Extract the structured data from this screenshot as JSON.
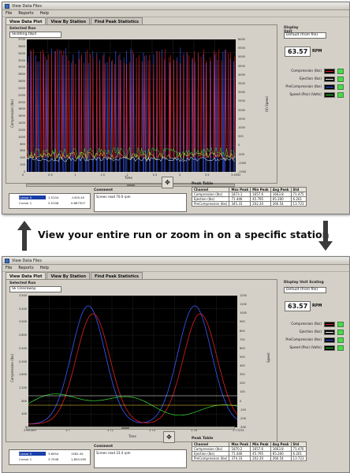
{
  "window_title": "View Data Files",
  "menu": [
    "File",
    "Reports",
    "Help"
  ],
  "tabs": [
    "View Data Plot",
    "View By Station",
    "Find Peak Statistics"
  ],
  "selected_run_label": "Selected Run",
  "selected_run_value": "Skidding.tdpd",
  "selected_run_value_2": "Sk Clearaway",
  "display_scaling_label": "Display Unit Scaling",
  "display_scaling_value": "Default (from file)",
  "rpm_value": "63.57",
  "rpm_unit": "RPM",
  "legend": [
    {
      "label": "Compression (lbs)",
      "color": "#e02020"
    },
    {
      "label": "Ejection (lbs)",
      "color": "#ffffff"
    },
    {
      "label": "PreCompression (lbs)",
      "color": "#3a5bff"
    },
    {
      "label": "Speed (Pos) (Volts)",
      "color": "#33dd33"
    }
  ],
  "time_label": "Time",
  "plot1": {
    "left_ticks": [
      "3700",
      "3600",
      "3400",
      "3200",
      "3000",
      "2800",
      "2600",
      "2400",
      "2200",
      "2000",
      "1800",
      "1600",
      "1400",
      "1200",
      "1000",
      "800",
      "600",
      "400",
      "200",
      "0"
    ],
    "right_ticks": [
      "6000",
      "5500",
      "5000",
      "4500",
      "4000",
      "3500",
      "3000",
      "2500",
      "2000",
      "1500",
      "1000",
      "500",
      "0",
      "-500",
      "-1000",
      "-1500"
    ],
    "x_ticks": [
      "0",
      "0.5",
      "1",
      "1.5",
      "2",
      "2.5",
      "3",
      "3.5",
      "3.4592"
    ],
    "left_title": "Compression (lbs)",
    "right_title": "(V) Speed"
  },
  "plot2": {
    "left_ticks": [
      "3.500",
      "3.400",
      "3.000",
      "2.800",
      "2.400",
      "2.000",
      "1.600",
      "1.200",
      "800",
      "400",
      "0"
    ],
    "right_ticks": [
      "1200",
      "1100",
      "1000",
      "900",
      "800",
      "700",
      "600",
      "500",
      "400",
      "300",
      "200",
      "100",
      "0",
      "-100",
      "-200",
      "-300"
    ],
    "x_ticks": [
      "3.69-469",
      "3.7",
      "3.72",
      "3.74",
      "3.76",
      "3.77233"
    ],
    "left_title": "Compression (lbs)",
    "right_title": "Speed"
  },
  "cursors_1": [
    {
      "name": "Cursor 0",
      "x": "1.5104",
      "y": "-1455.45"
    },
    {
      "name": "Cursor 1",
      "x": "2.5108",
      "y": "0.867307"
    }
  ],
  "cursors_2": [
    {
      "name": "Cursor 0",
      "x": "3.6954",
      "y": "1562.45"
    },
    {
      "name": "Cursor 1",
      "x": "3.7046",
      "y": "1,800.000"
    }
  ],
  "comment_label": "Comment",
  "comment_1": "Screen read 70.0 rpm",
  "comment_2": "Screen read 33.4 rpm",
  "peak_table_label": "Peak Table",
  "peak_headers": [
    "Channel",
    "Max Peak",
    "Min Peak",
    "Avg Peak",
    "Std"
  ],
  "peak_rows_1": [
    [
      "Compression (lbs)",
      "1873.1",
      "1657.6",
      "1663.8",
      "71.475"
    ],
    [
      "Ejection (lbs)",
      "71.446",
      "45.795",
      "65.200",
      "6.201"
    ],
    [
      "PreCompression (lbs)",
      "345.33",
      "202.20",
      "266.54",
      "13.723"
    ]
  ],
  "peak_rows_2": [
    [
      "Compression (lbs)",
      "1870.2",
      "1657.6",
      "1663.8",
      "71.476"
    ],
    [
      "Ejection (lbs)",
      "71.446",
      "45.795",
      "65.200",
      "6.201"
    ],
    [
      "PreCompression (lbs)",
      "374.33",
      "202.20",
      "266.54",
      "13.723"
    ]
  ],
  "caption": "View your entire run or zoom in on a specific station"
}
